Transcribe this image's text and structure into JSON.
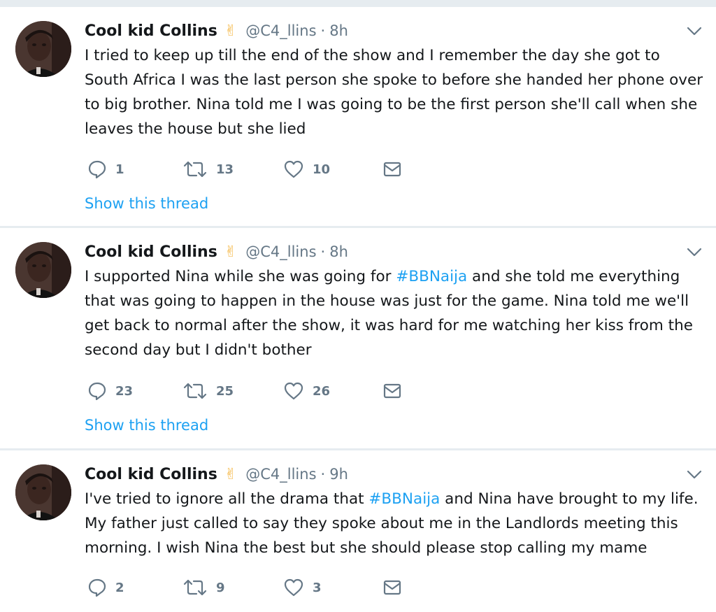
{
  "tweets": [
    {
      "name": "Cool kid Collins",
      "emoji": "✌",
      "handle": "@C4_llins",
      "separator": "·",
      "time": "8h",
      "lines": [
        [
          "I tried to keep up till the end of the show and I remember the day she got to"
        ],
        [
          "South Africa I was the last person she spoke to before she handed her phone over"
        ],
        [
          "to big brother. Nina told me I was going to be the first person she'll call when she"
        ],
        [
          "leaves the house but she lied"
        ]
      ],
      "replies": "1",
      "retweets": "13",
      "likes": "10",
      "show_thread": "Show this thread"
    },
    {
      "name": "Cool kid Collins",
      "emoji": "✌",
      "handle": "@C4_llins",
      "separator": "·",
      "time": "8h",
      "line1_before": "I supported Nina while she was going for ",
      "line1_hashtag": "#BBNaija",
      "line1_after": " and she told me everything",
      "lines_rest": [
        "that was going to happen in the house was just for the game. Nina told me we'll",
        "get back to normal after the show, it was hard for me watching her kiss from the",
        "second day but I didn't bother"
      ],
      "replies": "23",
      "retweets": "25",
      "likes": "26",
      "show_thread": "Show this thread"
    },
    {
      "name": "Cool kid Collins",
      "emoji": "✌",
      "handle": "@C4_llins",
      "separator": "·",
      "time": "9h",
      "line1_before": "I've tried to ignore all the drama that ",
      "line1_hashtag": "#BBNaija",
      "line1_after": " and Nina have brought to my life.",
      "lines_rest": [
        "My father just called to say they spoke about me in the Landlords meeting this",
        "morning. I wish Nina the best but she should please stop calling my mame"
      ],
      "replies": "2",
      "retweets": "9",
      "likes": "3"
    }
  ],
  "icons": {
    "reply": "reply-icon",
    "retweet": "retweet-icon",
    "like": "heart-icon",
    "dm": "envelope-icon",
    "caret": "chevron-down-icon"
  },
  "colors": {
    "link": "#1da1f2",
    "secondary": "#657786",
    "divider": "#e6ecf0"
  }
}
